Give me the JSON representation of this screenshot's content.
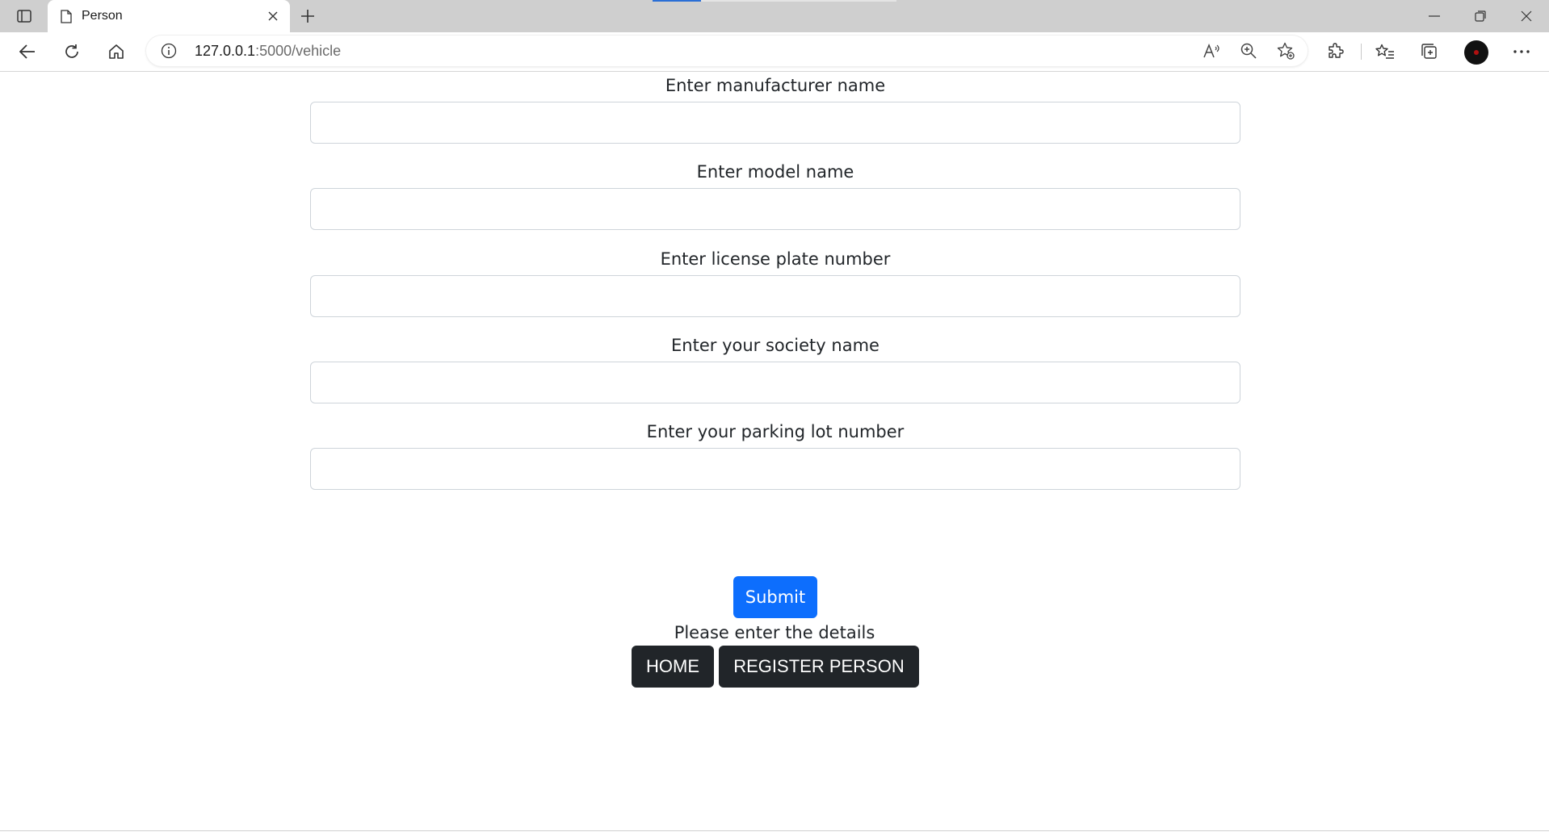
{
  "browser": {
    "tab": {
      "title": "Person"
    },
    "address": {
      "host": "127.0.0.1",
      "path": ":5000/vehicle"
    }
  },
  "form": {
    "fields": [
      {
        "label": "Enter manufacturer name",
        "value": ""
      },
      {
        "label": "Enter model name",
        "value": ""
      },
      {
        "label": "Enter license plate number",
        "value": ""
      },
      {
        "label": "Enter your society name",
        "value": ""
      },
      {
        "label": "Enter your parking lot number",
        "value": ""
      }
    ],
    "submit_label": "Submit",
    "message": "Please enter the details"
  },
  "nav": {
    "home_label": "HOME",
    "register_label": "REGISTER PERSON"
  },
  "colors": {
    "primary": "#0d6efd",
    "dark": "#212529"
  }
}
